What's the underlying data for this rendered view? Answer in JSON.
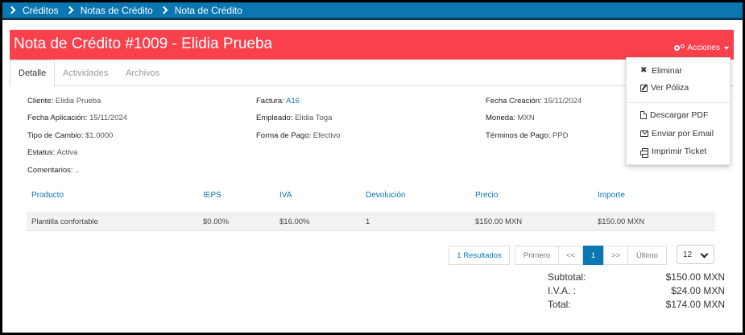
{
  "breadcrumb": {
    "items": [
      "Créditos",
      "Notas de Crédito",
      "Nota de Crédito"
    ]
  },
  "header": {
    "title": "Nota de Crédito #1009 - Elidia Prueba",
    "actions_label": "Acciones",
    "bg_color": "#f9414e"
  },
  "tabs": [
    "Detalle",
    "Actividades",
    "Archivos"
  ],
  "details": {
    "cliente": {
      "label": "Cliente:",
      "value": "Elidia Prueba"
    },
    "fecha_aplicacion": {
      "label": "Fecha Aplicación:",
      "value": "15/11/2024"
    },
    "tipo_cambio": {
      "label": "Tipo de Cambio:",
      "value": "$1.0000"
    },
    "estatus": {
      "label": "Estatus:",
      "value": "Activa"
    },
    "comentarios": {
      "label": "Comentarios:",
      "value": ".."
    },
    "factura": {
      "label": "Factura:",
      "value": "A16"
    },
    "empleado": {
      "label": "Empleado:",
      "value": "Elidia Toga"
    },
    "forma_pago": {
      "label": "Forma de Pago:",
      "value": "Efectivo"
    },
    "fecha_creacion": {
      "label": "Fecha Creación:",
      "value": "15/11/2024"
    },
    "moneda": {
      "label": "Moneda:",
      "value": "MXN"
    },
    "terminos_pago": {
      "label": "Términos de Pago:",
      "value": "PPD"
    }
  },
  "table": {
    "headers": [
      "Producto",
      "IEPS",
      "IVA",
      "Devolución",
      "Precio",
      "Importe"
    ],
    "rows": [
      [
        "Plantilla confortable",
        "$0.00%",
        "$16.00%",
        "1",
        "$150.00 MXN",
        "$150.00 MXN"
      ]
    ]
  },
  "pagination": {
    "results": "1 Resultados",
    "first": "Primero",
    "prev": "<<",
    "current": "1",
    "next": ">>",
    "last": "Último",
    "page_size": "12"
  },
  "totals": {
    "subtotal": {
      "label": "Subtotal:",
      "value": "$150.00 MXN"
    },
    "iva": {
      "label": "I.V.A. :",
      "value": "$24.00 MXN"
    },
    "total": {
      "label": "Total:",
      "value": "$174.00 MXN"
    }
  },
  "actions_menu": {
    "eliminar": "Eliminar",
    "ver_poliza": "Ver Póliza",
    "descargar_pdf": "Descargar PDF",
    "enviar_email": "Enviar por Email",
    "imprimir_ticket": "Imprimir Ticket"
  },
  "colors": {
    "primary": "#0a77b3",
    "header": "#f9414e"
  }
}
